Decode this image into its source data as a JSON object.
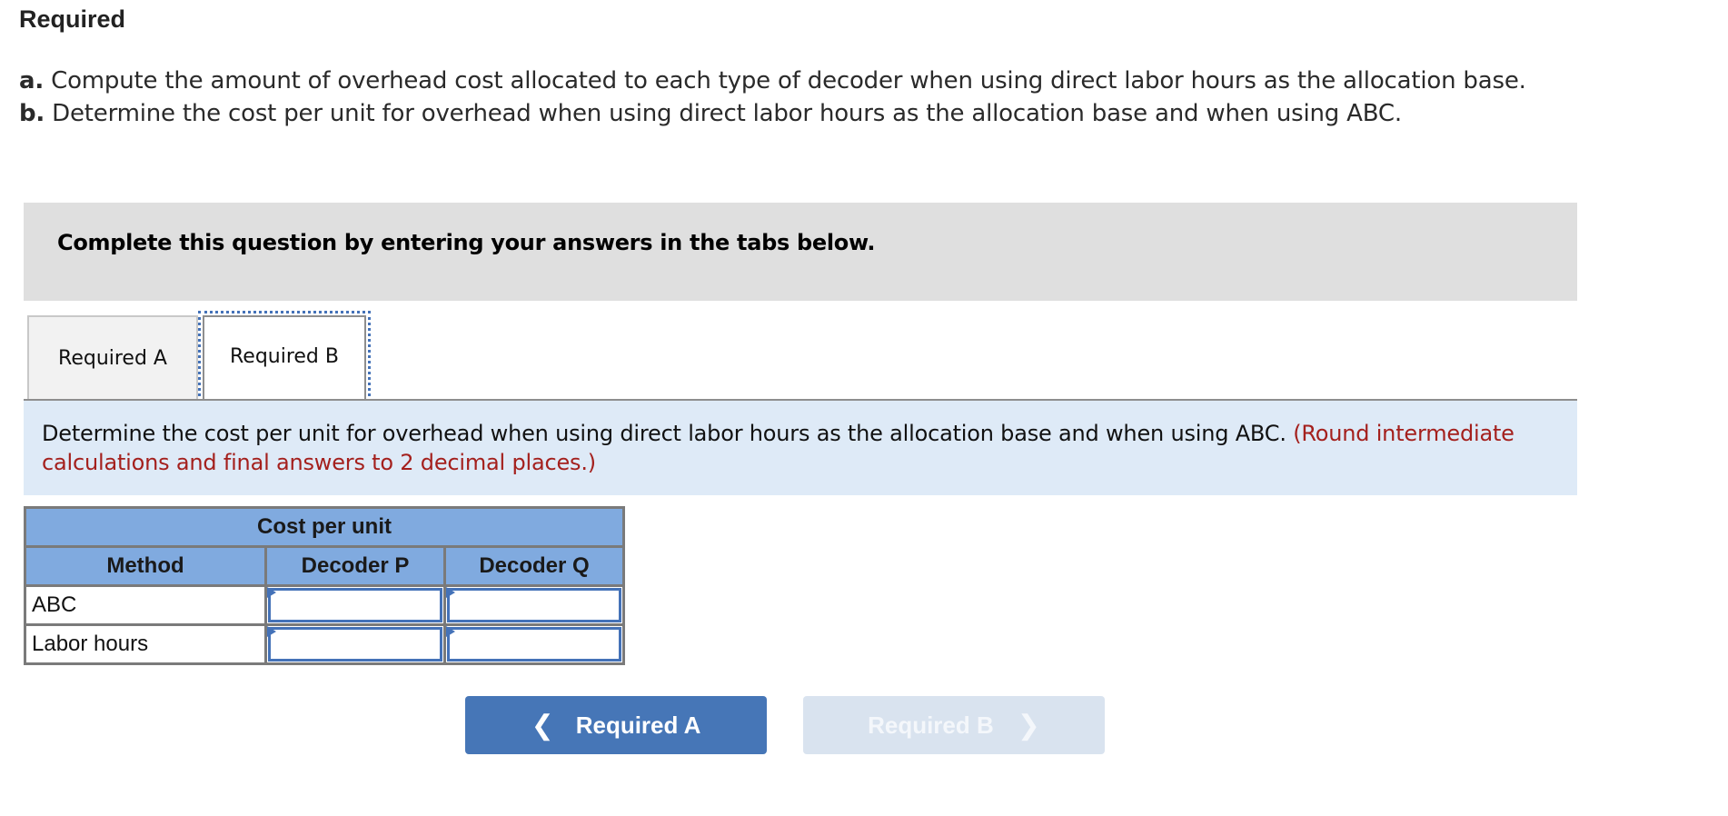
{
  "header": {
    "title": "Required",
    "items": [
      {
        "label": "a.",
        "text": "Compute the amount of overhead cost allocated to each type of decoder when using direct labor hours as the allocation base."
      },
      {
        "label": "b.",
        "text": "Determine the cost per unit for overhead when using direct labor hours as the allocation base and when using ABC."
      }
    ]
  },
  "instruction": "Complete this question by entering your answers in the tabs below.",
  "tabs": [
    {
      "label": "Required A",
      "active": false
    },
    {
      "label": "Required B",
      "active": true
    }
  ],
  "prompt": {
    "text": "Determine the cost per unit for overhead when using direct labor hours as the allocation base and when using ABC. ",
    "hint": "(Round intermediate calculations and final answers to 2 decimal places.)",
    "hint_color": "#a4201d"
  },
  "table": {
    "group_header": "Cost per unit",
    "columns": [
      "Method",
      "Decoder P",
      "Decoder Q"
    ],
    "rows": [
      {
        "label": "ABC",
        "values": [
          "",
          ""
        ]
      },
      {
        "label": "Labor hours",
        "values": [
          "",
          ""
        ]
      }
    ]
  },
  "nav": {
    "prev_label": "Required A",
    "next_label": "Required B",
    "prev_icon": "chevron-left-icon",
    "next_icon": "chevron-right-icon",
    "next_disabled": true
  },
  "colors": {
    "accent": "#4676b7",
    "table_header": "#80aadf",
    "prompt_bg": "#deeaf7",
    "instruction_bg": "#dfdfdf"
  }
}
